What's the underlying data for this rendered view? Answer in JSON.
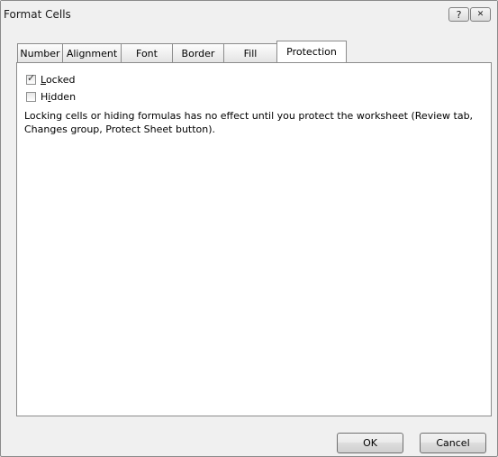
{
  "window": {
    "title": "Format Cells",
    "help_glyph": "?",
    "close_glyph": "✕"
  },
  "tabs": [
    {
      "label": "Number",
      "active": false
    },
    {
      "label": "Alignment",
      "active": false
    },
    {
      "label": "Font",
      "active": false
    },
    {
      "label": "Border",
      "active": false
    },
    {
      "label": "Fill",
      "active": false
    },
    {
      "label": "Protection",
      "active": true
    }
  ],
  "protection": {
    "locked": {
      "label_mnemonic": "L",
      "label_rest": "ocked",
      "checked": true
    },
    "hidden": {
      "label_pre": "H",
      "label_mnemonic": "i",
      "label_rest": "dden",
      "checked": false
    },
    "description": "Locking cells or hiding formulas has no effect until you protect the worksheet (Review tab, Changes group, Protect Sheet button)."
  },
  "buttons": {
    "ok": "OK",
    "cancel": "Cancel"
  },
  "check_glyph": "✓"
}
